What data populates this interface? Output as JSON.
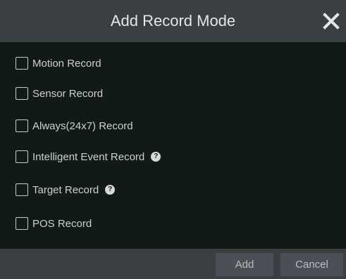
{
  "dialog": {
    "title": "Add Record Mode",
    "close_icon": "close-icon"
  },
  "options": [
    {
      "label": "Motion Record",
      "checked": false,
      "help": false
    },
    {
      "label": "Sensor Record",
      "checked": false,
      "help": false
    },
    {
      "label": "Always(24x7) Record",
      "checked": false,
      "help": false
    },
    {
      "label": "Intelligent Event Record",
      "checked": false,
      "help": true
    },
    {
      "label": "Target Record",
      "checked": false,
      "help": true
    },
    {
      "label": "POS Record",
      "checked": false,
      "help": false
    }
  ],
  "help_icon": {
    "glyph": "?",
    "name": "help-icon"
  },
  "footer": {
    "add_label": "Add",
    "cancel_label": "Cancel"
  },
  "colors": {
    "titlebar": "#3a3f44",
    "body": "#111a14",
    "text": "#cfcfcf"
  }
}
